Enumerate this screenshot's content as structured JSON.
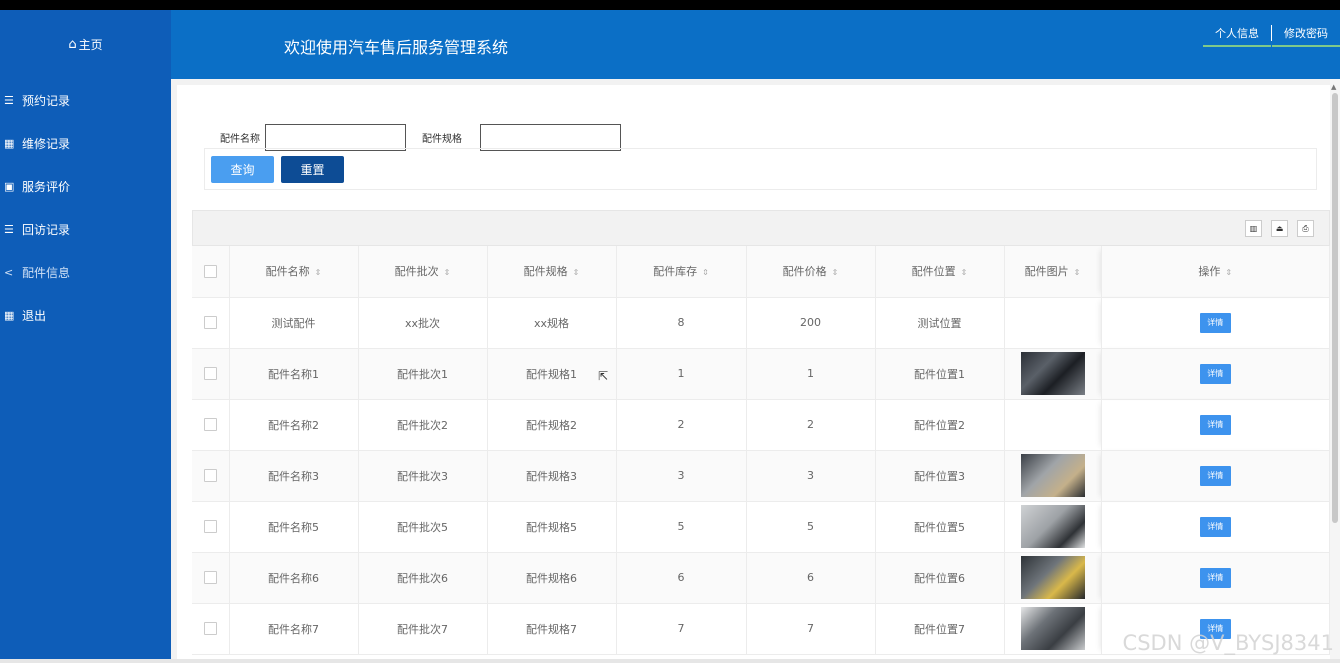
{
  "header": {
    "home_label": "主页",
    "system_title": "欢迎使用汽车售后服务管理系统",
    "user_info": "个人信息",
    "change_password": "修改密码"
  },
  "sidebar": {
    "items": [
      {
        "label": "预约记录",
        "icon": "list-icon"
      },
      {
        "label": "维修记录",
        "icon": "grid-icon"
      },
      {
        "label": "服务评价",
        "icon": "book-icon"
      },
      {
        "label": "回访记录",
        "icon": "list-icon"
      },
      {
        "label": "配件信息",
        "icon": "share-icon",
        "active": true
      },
      {
        "label": "退出",
        "icon": "grid-icon"
      }
    ]
  },
  "search": {
    "name_label": "配件名称",
    "spec_label": "配件规格",
    "name_value": "",
    "spec_value": "",
    "query_button": "查询",
    "reset_button": "重置"
  },
  "table": {
    "columns": [
      "配件名称",
      "配件批次",
      "配件规格",
      "配件库存",
      "配件价格",
      "配件位置",
      "配件图片",
      "操作"
    ],
    "detail_label": "详情",
    "rows": [
      {
        "name": "测试配件",
        "batch": "xx批次",
        "spec": "xx规格",
        "stock": "8",
        "price": "200",
        "location": "测试位置",
        "image": false
      },
      {
        "name": "配件名称1",
        "batch": "配件批次1",
        "spec": "配件规格1",
        "stock": "1",
        "price": "1",
        "location": "配件位置1",
        "image": true
      },
      {
        "name": "配件名称2",
        "batch": "配件批次2",
        "spec": "配件规格2",
        "stock": "2",
        "price": "2",
        "location": "配件位置2",
        "image": false
      },
      {
        "name": "配件名称3",
        "batch": "配件批次3",
        "spec": "配件规格3",
        "stock": "3",
        "price": "3",
        "location": "配件位置3",
        "image": true
      },
      {
        "name": "配件名称5",
        "batch": "配件批次5",
        "spec": "配件规格5",
        "stock": "5",
        "price": "5",
        "location": "配件位置5",
        "image": true
      },
      {
        "name": "配件名称6",
        "batch": "配件批次6",
        "spec": "配件规格6",
        "stock": "6",
        "price": "6",
        "location": "配件位置6",
        "image": true
      },
      {
        "name": "配件名称7",
        "batch": "配件批次7",
        "spec": "配件规格7",
        "stock": "7",
        "price": "7",
        "location": "配件位置7",
        "image": true
      }
    ]
  },
  "watermark": "CSDN @V_BYSJ8341",
  "colors": {
    "header_blue": "#0b6fc6",
    "sidebar_blue": "#0e5db8",
    "query_button": "#4a9ef0",
    "reset_button": "#0d4c95",
    "detail_button": "#3d93ee"
  }
}
